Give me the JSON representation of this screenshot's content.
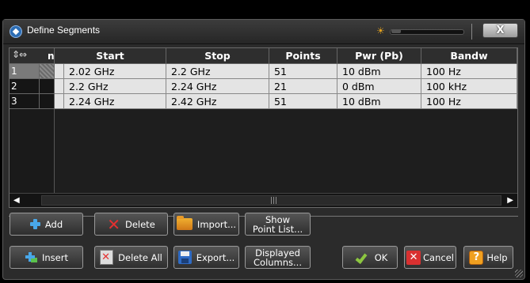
{
  "window": {
    "title": "Define Segments",
    "close_label": "X"
  },
  "icons": {
    "app": "app-logo-icon",
    "brightness": "brightness-icon",
    "add": "plus-icon",
    "insert": "insert-icon",
    "delete": "x-icon",
    "delete_all": "delete-all-icon",
    "import": "folder-icon",
    "export": "floppy-icon",
    "ok": "checkmark-icon",
    "cancel": "cancel-icon",
    "help": "help-icon"
  },
  "table": {
    "corner_label": "n",
    "columns": [
      "Start",
      "Stop",
      "Points",
      "Pwr (Pb)",
      "Bandw"
    ],
    "rows": [
      {
        "n": "1",
        "start": "2.02 GHz",
        "stop": "2.2 GHz",
        "points": "51",
        "pwr": "10 dBm",
        "bandw": "100 Hz"
      },
      {
        "n": "2",
        "start": "2.2 GHz",
        "stop": "2.24 GHz",
        "points": "21",
        "pwr": "0 dBm",
        "bandw": "100 kHz"
      },
      {
        "n": "3",
        "start": "2.24 GHz",
        "stop": "2.42 GHz",
        "points": "51",
        "pwr": "10 dBm",
        "bandw": "100 Hz"
      }
    ],
    "selected_row": 1
  },
  "buttons": {
    "add": "Add",
    "delete": "Delete",
    "import": "Import...",
    "show_point_list_line1": "Show",
    "show_point_list_line2": "Point List...",
    "insert": "Insert",
    "delete_all": "Delete All",
    "export": "Export...",
    "displayed_columns_line1": "Displayed",
    "displayed_columns_line2": "Columns...",
    "ok": "OK",
    "cancel": "Cancel",
    "help": "Help"
  },
  "colors": {
    "accent": "#49a7e8",
    "ok_green": "#8cc640",
    "cancel_red": "#d93030",
    "help_orange": "#f0a020"
  }
}
